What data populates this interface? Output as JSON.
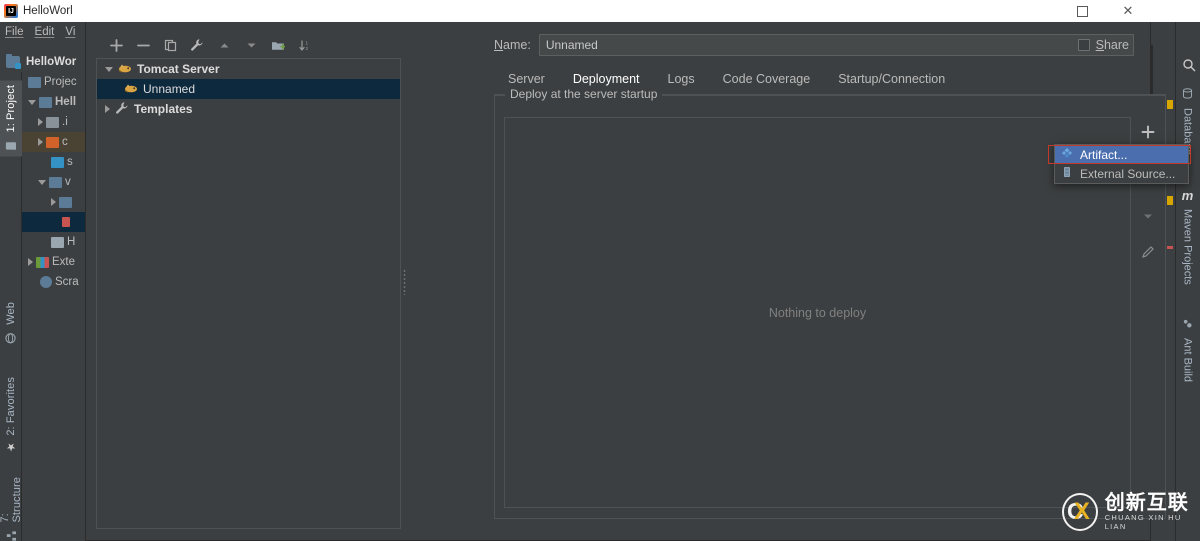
{
  "ide": {
    "title": "HelloWorl",
    "menu_items": [
      "File",
      "Edit",
      "Vi"
    ],
    "project_label": "HelloWor",
    "tool_tab_project": "1: Project",
    "left_tabs": [
      {
        "label": "1: Project",
        "icon": "project-icon"
      },
      {
        "label": "Web",
        "icon": "web-icon"
      },
      {
        "label": "2: Favorites",
        "icon": "star-icon"
      },
      {
        "label": "7: Structure",
        "icon": "structure-icon"
      }
    ],
    "right_tabs": [
      {
        "label": "Database",
        "icon": "database-icon"
      },
      {
        "label": "Maven Projects",
        "icon": "maven-icon"
      },
      {
        "label": "Ant Build",
        "icon": "ant-icon"
      }
    ],
    "project_panel_header": "Projec",
    "tree": [
      {
        "label": "Hell",
        "arrow": "down",
        "icon": "module-folder-icon",
        "bold": true
      },
      {
        "label": ".i",
        "arrow": "right",
        "icon": "folder-icon",
        "bold": false
      },
      {
        "label": "c",
        "arrow": "right",
        "icon": "source-folder-icon",
        "bold": false
      },
      {
        "label": "s",
        "arrow": "none",
        "icon": "folder-icon",
        "bold": false
      },
      {
        "label": "v",
        "arrow": "down",
        "icon": "folder-icon",
        "bold": false
      },
      {
        "label": "",
        "arrow": "right",
        "icon": "folder-icon",
        "bold": false
      },
      {
        "label": "",
        "arrow": "none",
        "icon": "file-icon",
        "bold": false,
        "selected": true
      },
      {
        "label": "H",
        "arrow": "none",
        "icon": "java-file-icon",
        "bold": false
      },
      {
        "label": "Exte",
        "arrow": "right",
        "icon": "libraries-icon",
        "bold": false
      },
      {
        "label": "Scra",
        "arrow": "none",
        "icon": "scratches-icon",
        "bold": false
      }
    ]
  },
  "window_controls": {
    "maximize": "maximize",
    "close": "✕"
  },
  "dialog": {
    "left_toolbar": [
      {
        "name": "add-button",
        "icon": "plus-icon"
      },
      {
        "name": "remove-button",
        "icon": "minus-icon"
      },
      {
        "name": "copy-button",
        "icon": "copy-icon"
      },
      {
        "name": "edit-templates-button",
        "icon": "wrench-icon"
      },
      {
        "name": "move-up-button",
        "icon": "arrow-up-icon"
      },
      {
        "name": "move-down-button",
        "icon": "arrow-down-icon"
      },
      {
        "name": "new-folder-button",
        "icon": "folder-add-icon"
      },
      {
        "name": "sort-button",
        "icon": "sort-icon"
      }
    ],
    "tree": [
      {
        "label": "Tomcat Server",
        "arrow": "down",
        "icon": "tomcat-icon",
        "bold": true,
        "selected": false
      },
      {
        "label": "Unnamed",
        "arrow": "none",
        "icon": "tomcat-icon",
        "bold": false,
        "selected": true
      },
      {
        "label": "Templates",
        "arrow": "right",
        "icon": "wrench-icon",
        "bold": true,
        "selected": false
      }
    ],
    "name_label": "Name:",
    "name_label_mnemonic": "N",
    "name_label_rest": "ame:",
    "name_value": "Unnamed",
    "share_label": "Share",
    "share_mnemonic": "S",
    "share_rest": "hare",
    "share_checked": false,
    "tabs": [
      {
        "label": "Server",
        "active": false
      },
      {
        "label": "Deployment",
        "active": true
      },
      {
        "label": "Logs",
        "active": false
      },
      {
        "label": "Code Coverage",
        "active": false
      },
      {
        "label": "Startup/Connection",
        "active": false
      }
    ],
    "group_title": "Deploy at the server startup",
    "empty_text": "Nothing to deploy",
    "side_tools": [
      {
        "name": "add-deployment-button",
        "icon": "plus-icon"
      },
      {
        "name": "move-down-deployment-button",
        "icon": "chevron-down-icon"
      },
      {
        "name": "edit-deployment-button",
        "icon": "pencil-icon"
      }
    ],
    "popup_menu": {
      "items": [
        {
          "label": "Artifact...",
          "icon": "artifact-icon",
          "selected": true
        },
        {
          "label": "External Source...",
          "icon": "external-source-icon",
          "selected": false
        }
      ]
    }
  },
  "watermark": {
    "chinese": "创新互联",
    "pinyin": "CHUANG XIN HU LIAN",
    "letter_c": "C",
    "letter_x": "X"
  },
  "colors": {
    "background": "#3c3f41",
    "panel_border": "#4e5254",
    "selection_tree": "#0d293e",
    "selection_menu": "#4b6eaf",
    "tab_underline": "#4a88c7",
    "annotation_red": "#c0392b",
    "text": "#bbbbbb",
    "muted_text": "#808080",
    "titlebar": "#ffffff",
    "accent_orange": "#e8b122"
  }
}
